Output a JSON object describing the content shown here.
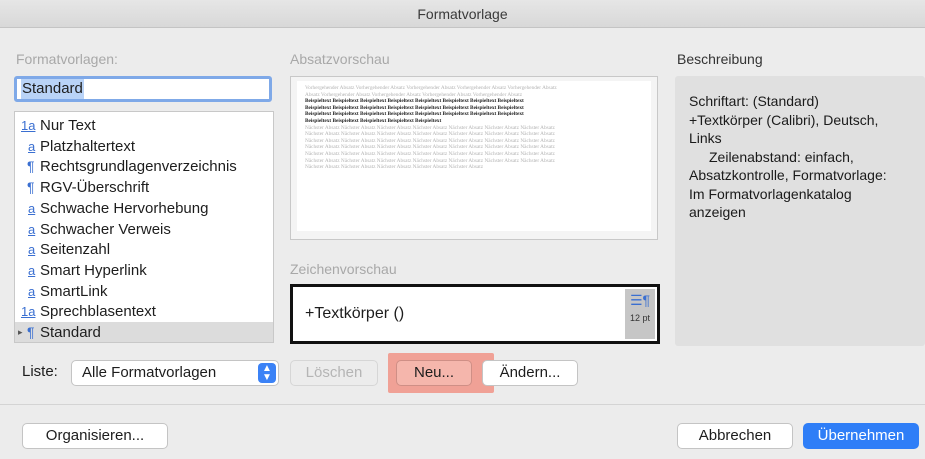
{
  "window": {
    "title": "Formatvorlage"
  },
  "labels": {
    "formatvorlagen": "Formatvorlagen:",
    "absatzvorschau": "Absatzvorschau",
    "zeichenvorschau": "Zeichenvorschau",
    "beschreibung": "Beschreibung",
    "liste": "Liste:"
  },
  "name_field": {
    "value": "Standard"
  },
  "styles": [
    {
      "icon": "1a",
      "label": "Nur Text",
      "selected": false
    },
    {
      "icon": "a",
      "label": "Platzhaltertext",
      "selected": false
    },
    {
      "icon": "¶",
      "label": "Rechtsgrundlagenverzeichnis",
      "selected": false
    },
    {
      "icon": "¶",
      "label": "RGV-Überschrift",
      "selected": false
    },
    {
      "icon": "a",
      "label": "Schwache Hervorhebung",
      "selected": false
    },
    {
      "icon": "a",
      "label": "Schwacher Verweis",
      "selected": false
    },
    {
      "icon": "a",
      "label": "Seitenzahl",
      "selected": false
    },
    {
      "icon": "a",
      "label": "Smart Hyperlink",
      "selected": false
    },
    {
      "icon": "a",
      "label": "SmartLink",
      "selected": false
    },
    {
      "icon": "1a",
      "label": "Sprechblasentext",
      "selected": false
    },
    {
      "icon": "¶",
      "label": "Standard",
      "selected": true,
      "expandable": true
    }
  ],
  "paragraph_preview": {
    "previous_lines": [
      "Vorhergehender Absatz Vorhergehender Absatz Vorhergehender Absatz Vorhergehender Absatz Vorhergehender Absatz",
      "Absatz Vorhergehender Absatz Vorhergehender Absatz Vorhergehender Absatz Vorhergehender Absatz"
    ],
    "sample_lines": [
      "Beispieltext Beispieltext Beispieltext Beispieltext Beispieltext Beispieltext Beispieltext Beispieltext",
      "Beispieltext Beispieltext Beispieltext Beispieltext Beispieltext Beispieltext Beispieltext Beispieltext",
      "Beispieltext Beispieltext Beispieltext Beispieltext Beispieltext Beispieltext Beispieltext Beispieltext",
      "Beispieltext Beispieltext Beispieltext Beispieltext Beispieltext"
    ],
    "following_lines": [
      "Nächster Absatz Nächster Absatz Nächster Absatz Nächster Absatz Nächster Absatz Nächster Absatz Nächster Absatz",
      "Nächster Absatz Nächster Absatz Nächster Absatz Nächster Absatz Nächster Absatz Nächster Absatz Nächster Absatz",
      "Nächster Absatz Nächster Absatz Nächster Absatz Nächster Absatz Nächster Absatz Nächster Absatz Nächster Absatz",
      "Nächster Absatz Nächster Absatz Nächster Absatz Nächster Absatz Nächster Absatz Nächster Absatz Nächster Absatz",
      "Nächster Absatz Nächster Absatz Nächster Absatz Nächster Absatz Nächster Absatz Nächster Absatz Nächster Absatz",
      "Nächster Absatz Nächster Absatz Nächster Absatz Nächster Absatz Nächster Absatz Nächster Absatz Nächster Absatz",
      "Nächster Absatz Nächster Absatz Nächster Absatz Nächster Absatz Nächster Absatz"
    ]
  },
  "character_preview": {
    "text": "+Textkörper ()",
    "size": "12 pt"
  },
  "description": {
    "line1": "Schriftart: (Standard)",
    "line2": "+Textkörper (Calibri), Deutsch,",
    "line3": "Links",
    "line4": "Zeilenabstand:  einfach,",
    "line5": "Absatzkontrolle, Formatvorlage:",
    "line6": "Im Formatvorlagenkatalog",
    "line7": "anzeigen"
  },
  "list_select": {
    "value": "Alle Formatvorlagen"
  },
  "buttons": {
    "loeschen": "Löschen",
    "neu": "Neu...",
    "aendern": "Ändern...",
    "organisieren": "Organisieren...",
    "abbrechen": "Abbrechen",
    "uebernehmen": "Übernehmen"
  },
  "colors": {
    "accent": "#2f7ef7",
    "style_icon": "#3a6fd1",
    "highlight": "#f0a196"
  }
}
